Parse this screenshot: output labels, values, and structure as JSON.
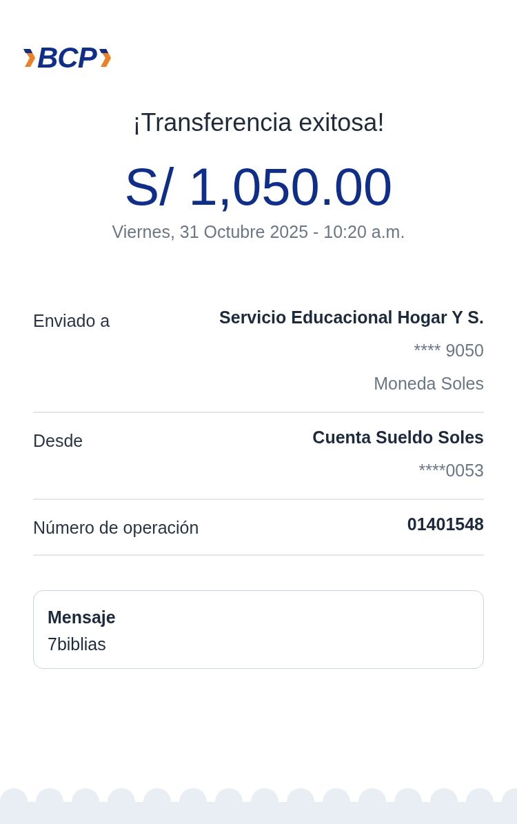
{
  "logo": {
    "text": "BCP"
  },
  "title": "¡Transferencia exitosa!",
  "amount": "S/ 1,050.00",
  "datetime": "Viernes, 31 Octubre 2025 - 10:20 a.m.",
  "details": [
    {
      "label": "Enviado a",
      "values": [
        "Servicio Educacional Hogar Y S.",
        "**** 9050",
        "Moneda Soles"
      ]
    },
    {
      "label": "Desde",
      "values": [
        "Cuenta Sueldo Soles",
        "****0053"
      ]
    },
    {
      "label": "Número de operación",
      "values": [
        "01401548"
      ]
    }
  ],
  "message": {
    "title": "Mensaje",
    "text": "7biblias"
  }
}
